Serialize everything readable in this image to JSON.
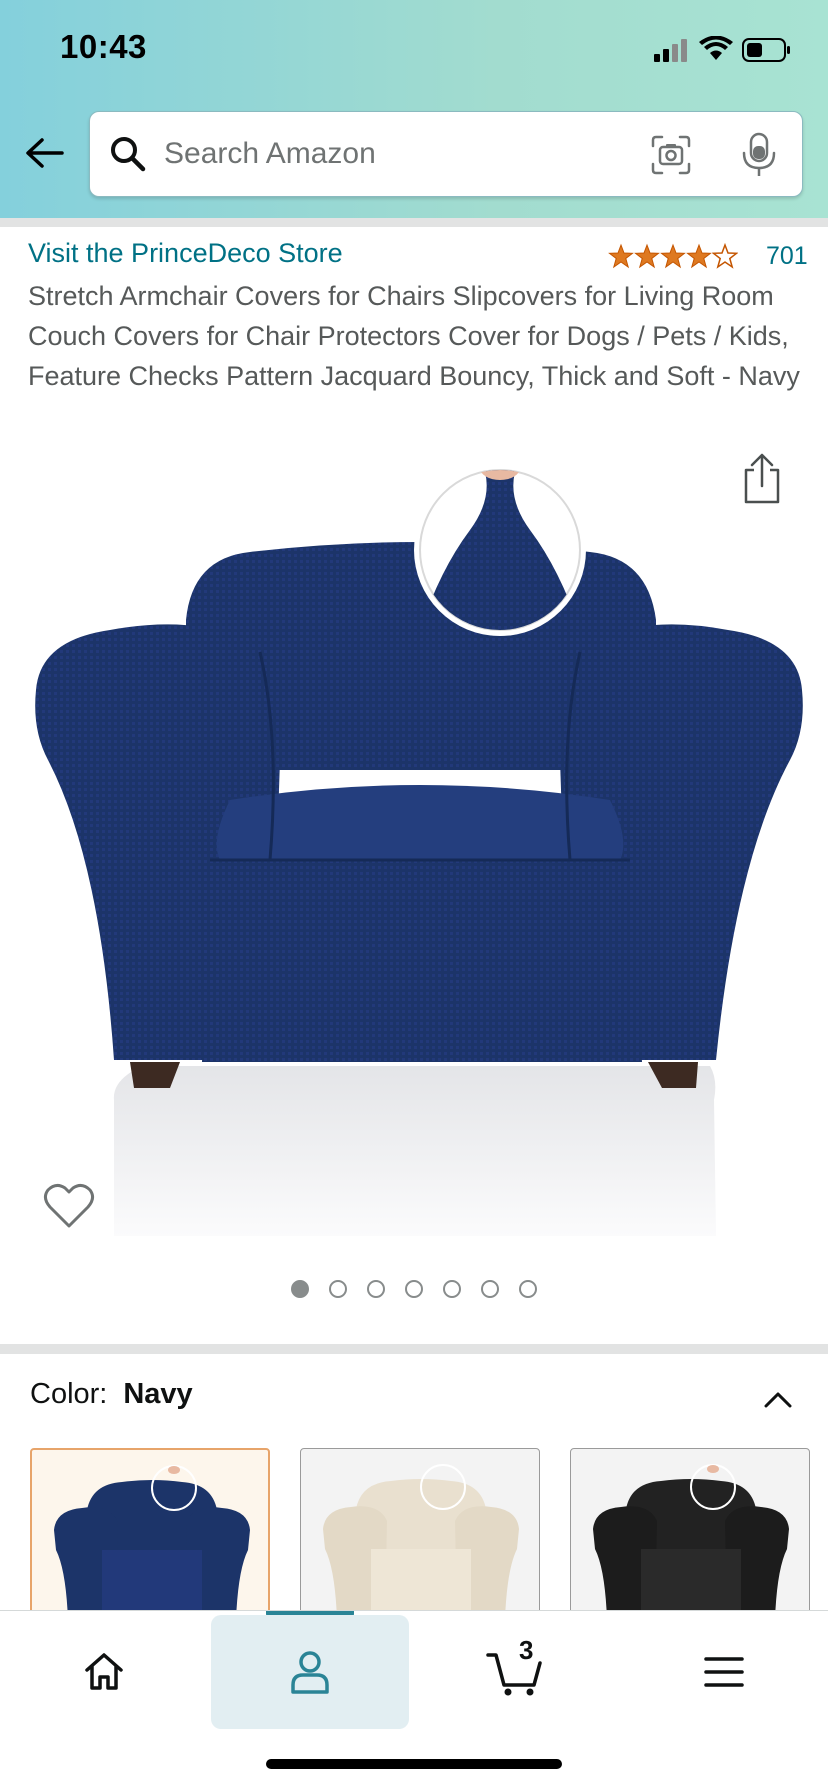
{
  "status_bar": {
    "time": "10:43"
  },
  "search": {
    "placeholder": "Search Amazon"
  },
  "product": {
    "store_link": "Visit the PrinceDeco Store",
    "rating_value": 4.5,
    "rating_count": "701",
    "title": "Stretch Armchair Covers for Chairs Slipcovers for Living Room Couch Covers for Chair Protectors Cover for Dogs / Pets / Kids, Feature Checks Pattern Jacquard Bouncy, Thick and Soft - Navy"
  },
  "image_carousel": {
    "total": 7,
    "active_index": 0
  },
  "color_section": {
    "label": "Color:",
    "selected": "Navy",
    "swatches": [
      {
        "name": "Navy",
        "color": "#1c3469",
        "selected": true
      },
      {
        "name": "Cream",
        "color": "#e9e0cf",
        "selected": false
      },
      {
        "name": "Black",
        "color": "#222222",
        "selected": false
      }
    ]
  },
  "bottom_nav": {
    "items": [
      "home",
      "account",
      "cart",
      "menu"
    ],
    "active": "account",
    "cart_count": "3"
  },
  "colors": {
    "link": "#007185",
    "star": "#de7921",
    "active_tab": "#2a8496"
  }
}
